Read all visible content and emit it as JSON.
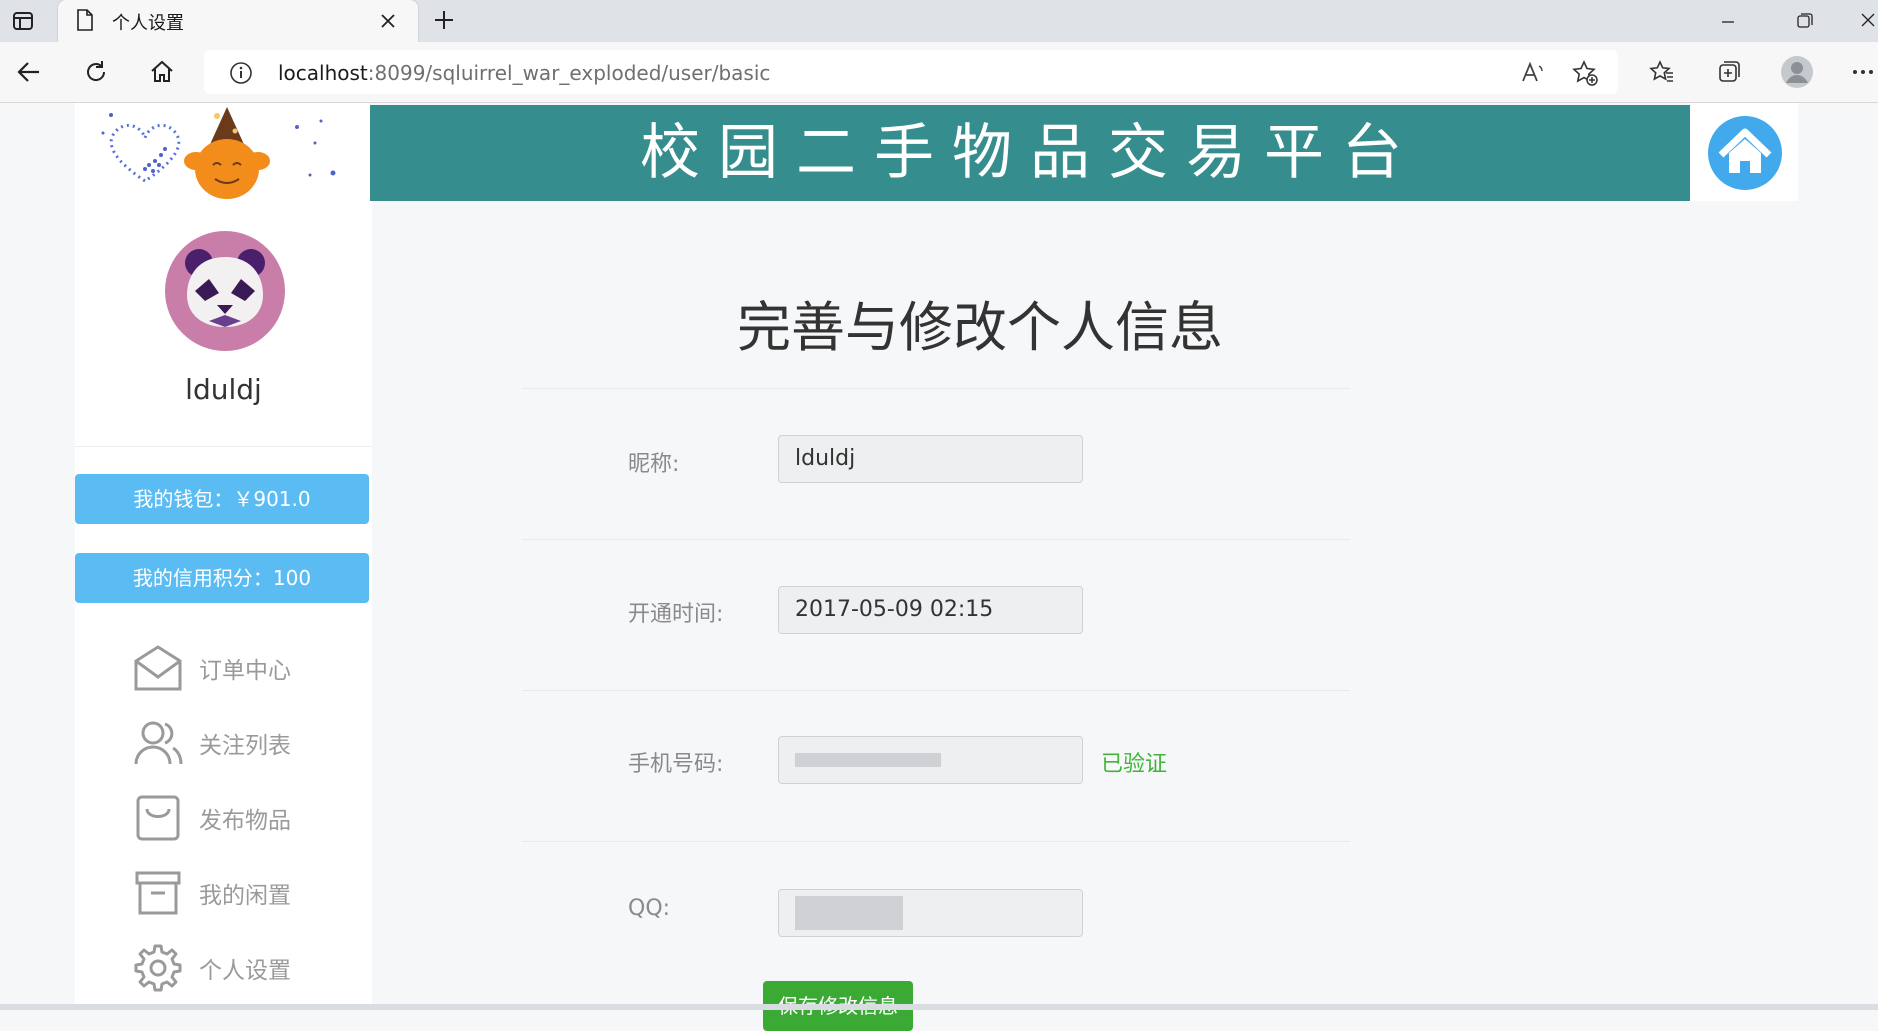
{
  "browser": {
    "tab_title": "个人设置",
    "url_host": "localhost",
    "url_rest": ":8099/sqluirrel_war_exploded/user/basic",
    "icons": [
      "sidebar-toggle-icon",
      "page-icon",
      "close-icon",
      "new-tab-icon",
      "back-icon",
      "refresh-icon",
      "home-icon",
      "info-icon",
      "read-aloud-icon",
      "add-favorite-icon",
      "favorites-icon",
      "collections-icon",
      "profile-icon",
      "more-icon",
      "minimize-icon",
      "restore-icon",
      "window-close-icon"
    ]
  },
  "header": {
    "banner_title": "校园二手物品交易平台"
  },
  "sidebar": {
    "username": "lduldj",
    "wallet": "我的钱包：￥901.0",
    "credit": "我的信用积分：100",
    "menu": [
      {
        "label": "订单中心",
        "icon": "envelope-icon"
      },
      {
        "label": "关注列表",
        "icon": "users-icon"
      },
      {
        "label": "发布物品",
        "icon": "bag-icon"
      },
      {
        "label": "我的闲置",
        "icon": "archive-icon"
      },
      {
        "label": "个人设置",
        "icon": "gear-icon"
      }
    ]
  },
  "form": {
    "title": "完善与修改个人信息",
    "nickname_label": "昵称:",
    "nickname_value": "lduldj",
    "opened_label": "开通时间:",
    "opened_value": "2017-05-09 02:15",
    "phone_label": "手机号码:",
    "phone_status": "已验证",
    "qq_label": "QQ:",
    "save_label": "保存修改信息"
  },
  "colors": {
    "banner": "#368d8e",
    "wallet_button": "#5bbcf4",
    "verified": "#3fb33a",
    "save_button": "#3aaa35"
  }
}
